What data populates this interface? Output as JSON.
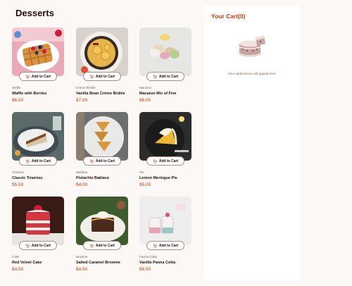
{
  "page": {
    "title": "Desserts"
  },
  "products": [
    {
      "category": "Waffle",
      "name": "Waffle with Berries",
      "price": "$6.50",
      "button": "Add to Cart",
      "image": "waffle-image"
    },
    {
      "category": "Crème Brûlée",
      "name": "Vanilla Bean Crème Brûlée",
      "price": "$7.00",
      "button": "Add to Cart",
      "image": "creme-brulee-image"
    },
    {
      "category": "Macaron",
      "name": "Macaron Mix of Five",
      "price": "$8.00",
      "button": "Add to Cart",
      "image": "macaron-image"
    },
    {
      "category": "Tiramisu",
      "name": "Classic Tiramisu",
      "price": "$5.50",
      "button": "Add to Cart",
      "image": "tiramisu-image"
    },
    {
      "category": "Baklava",
      "name": "Pistachio Baklava",
      "price": "$4.00",
      "button": "Add to Cart",
      "image": "baklava-image"
    },
    {
      "category": "Pie",
      "name": "Lemon Meringue Pie",
      "price": "$5.00",
      "button": "Add to Cart",
      "image": "pie-image"
    },
    {
      "category": "Cake",
      "name": "Red Velvet Cake",
      "price": "$4.50",
      "button": "Add to Cart",
      "image": "cake-image"
    },
    {
      "category": "Brownie",
      "name": "Salted Caramel Brownie",
      "price": "$4.50",
      "button": "Add to Cart",
      "image": "brownie-image"
    },
    {
      "category": "Panna Cotta",
      "name": "Vanilla Panna Cotta",
      "price": "$6.50",
      "button": "Add to Cart",
      "image": "panna-cotta-image"
    }
  ],
  "cart": {
    "title": "Your Cart(0)",
    "empty_message": "Your added items will appear here",
    "illustration": "empty-cart-cake-icon"
  },
  "colors": {
    "background": "#fcf8f6",
    "accent": "#c73b0f",
    "text": "#260f08",
    "muted": "#87635a",
    "button_border": "#ad8a85"
  }
}
